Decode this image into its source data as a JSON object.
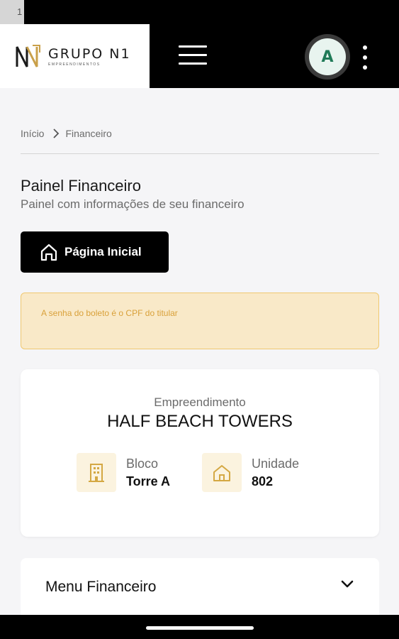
{
  "status_bar": {
    "marker": "1"
  },
  "header": {
    "logo": {
      "name": "GRUPO N1",
      "sub": "EMPREENDIMENTOS"
    },
    "menu_icon": "hamburger-icon",
    "avatar_letter": "A",
    "more_icon": "kebab-icon"
  },
  "breadcrumb": {
    "home": "Início",
    "current": "Financeiro"
  },
  "page": {
    "title": "Painel Financeiro",
    "subtitle": "Painel com informações de seu financeiro"
  },
  "home_button": {
    "label": "Página Inicial",
    "icon": "home-icon"
  },
  "alert": {
    "text": "A senha do boleto é o CPF do titular"
  },
  "property": {
    "label": "Empreendimento",
    "name": "HALF BEACH TOWERS",
    "block": {
      "label": "Bloco",
      "value": "Torre A",
      "icon": "building-icon"
    },
    "unit": {
      "label": "Unidade",
      "value": "802",
      "icon": "house-icon"
    }
  },
  "menu": {
    "title": "Menu Financeiro",
    "icon": "chevron-down-icon"
  },
  "colors": {
    "accent_gold": "#d4a843",
    "alert_bg": "#f9e9c8",
    "alert_border": "#f0c870",
    "avatar_green": "#1f7a57"
  }
}
